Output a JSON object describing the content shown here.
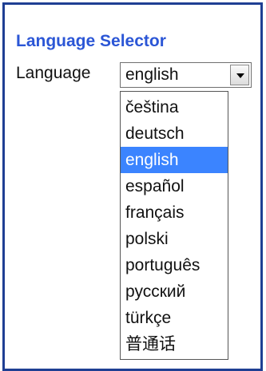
{
  "title": "Language Selector",
  "field_label": "Language",
  "select": {
    "value": "english",
    "options": [
      {
        "label": "čeština"
      },
      {
        "label": "deutsch"
      },
      {
        "label": "english"
      },
      {
        "label": "español"
      },
      {
        "label": "français"
      },
      {
        "label": "polski"
      },
      {
        "label": "português"
      },
      {
        "label": "русский"
      },
      {
        "label": "türkçe"
      },
      {
        "label": "普通话"
      }
    ]
  },
  "colors": {
    "border": "#1f3f93",
    "title": "#2b56d6",
    "highlight": "#3b84ff"
  }
}
